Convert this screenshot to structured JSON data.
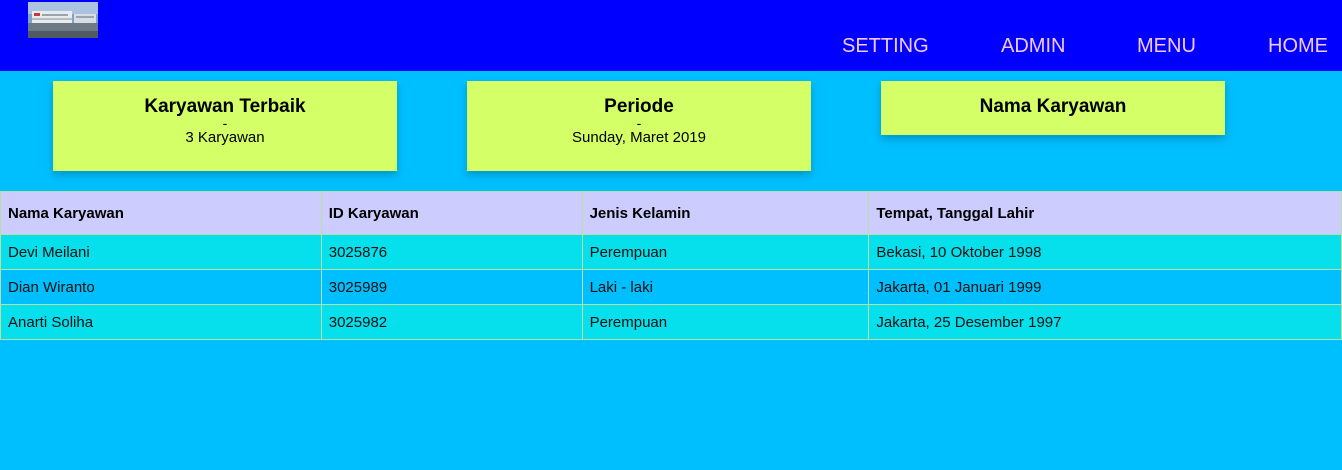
{
  "header": {
    "logo_alt": "",
    "nav": [
      {
        "label": "SETTING"
      },
      {
        "label": "ADMIN"
      },
      {
        "label": "MENU"
      },
      {
        "label": "HOME"
      }
    ]
  },
  "cards": [
    {
      "title": "Karyawan Terbaik",
      "dash": "-",
      "subtitle": "3 Karyawan"
    },
    {
      "title": "Periode",
      "dash": "-",
      "subtitle": "Sunday, Maret 2019"
    },
    {
      "title": "Nama Karyawan",
      "dash": "",
      "subtitle": ""
    }
  ],
  "table": {
    "columns": [
      "Nama Karyawan",
      "ID Karyawan",
      "Jenis Kelamin",
      "Tempat, Tanggal Lahir"
    ],
    "rows": [
      [
        "Devi Meilani",
        "3025876",
        "Perempuan",
        "Bekasi, 10 Oktober 1998"
      ],
      [
        "Dian Wiranto",
        "3025989",
        "Laki - laki",
        "Jakarta, 01 Januari 1999"
      ],
      [
        "Anarti Soliha",
        "3025982",
        "Perempuan",
        "Jakarta, 25 Desember 1997"
      ]
    ]
  },
  "colors": {
    "page_background": "#00bfff",
    "header_background": "#0000ff",
    "nav_text": "#f2c9f5",
    "card_background": "#d4ff66",
    "table_header_background": "#ccccff",
    "row_odd_background": "#06dfec",
    "row_even_background": "#00bfff"
  }
}
